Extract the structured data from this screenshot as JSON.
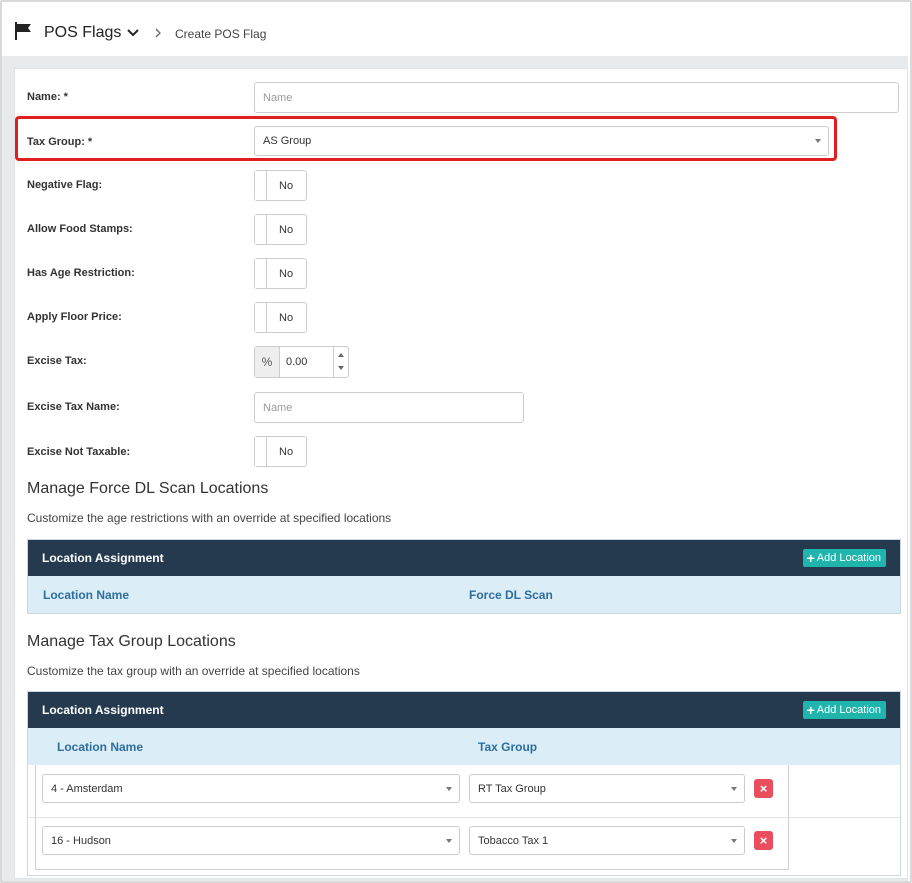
{
  "header": {
    "title": "POS Flags",
    "breadcrumb": "Create POS Flag"
  },
  "form": {
    "name_label": "Name: *",
    "name_placeholder": "Name",
    "tax_group_label": "Tax Group: *",
    "tax_group_value": "AS Group",
    "negative_flag_label": "Negative Flag:",
    "negative_flag_value": "No",
    "food_stamps_label": "Allow Food Stamps:",
    "food_stamps_value": "No",
    "age_restriction_label": "Has Age Restriction:",
    "age_restriction_value": "No",
    "floor_price_label": "Apply Floor Price:",
    "floor_price_value": "No",
    "excise_tax_label": "Excise Tax:",
    "excise_tax_addon": "%",
    "excise_tax_value": "0.00",
    "excise_tax_name_label": "Excise Tax Name:",
    "excise_tax_name_placeholder": "Name",
    "excise_not_taxable_label": "Excise Not Taxable:",
    "excise_not_taxable_value": "No"
  },
  "force_dl": {
    "heading": "Manage Force DL Scan Locations",
    "description": "Customize the age restrictions with an override at specified locations",
    "table_title": "Location Assignment",
    "add_label": "Add Location",
    "columns": [
      "Location Name",
      "Force DL Scan"
    ]
  },
  "tax_groups": {
    "heading": "Manage Tax Group Locations",
    "description": "Customize the tax group with an override at specified locations",
    "table_title": "Location Assignment",
    "add_label": "Add Location",
    "columns": [
      "Location Name",
      "Tax Group"
    ],
    "rows": [
      {
        "location": "4 - Amsterdam",
        "tax_group": "RT Tax Group",
        "delete": "×"
      },
      {
        "location": "16 - Hudson",
        "tax_group": "Tobacco Tax 1",
        "delete": "×"
      }
    ]
  },
  "colors": {
    "table_header": "#263a4f",
    "add_button": "#1fb5ad",
    "column_header_bg": "#dbedf7",
    "column_header_text": "#2d6e9d",
    "delete_button": "#ea4d5c",
    "highlight": "#e02020"
  }
}
